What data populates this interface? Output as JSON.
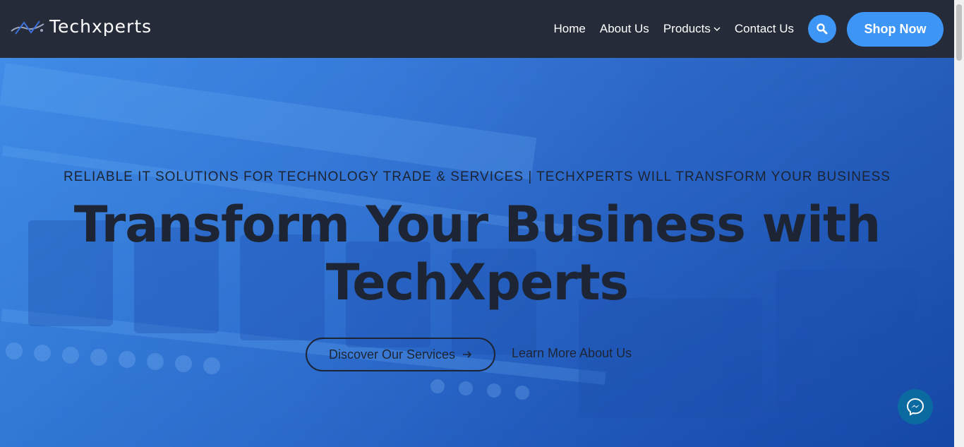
{
  "header": {
    "logo_text": "Techxperts",
    "nav": [
      {
        "label": "Home"
      },
      {
        "label": "About Us"
      },
      {
        "label": "Products"
      },
      {
        "label": "Contact Us"
      }
    ],
    "shop_label": "Shop Now"
  },
  "hero": {
    "tagline": "RELIABLE IT SOLUTIONS FOR TECHNOLOGY TRADE & SERVICES | TECHXPERTS WILL TRANSFORM YOUR BUSINESS",
    "headline_line1": "Transform Your Business with",
    "headline_line2": "TechXperts",
    "discover_label": "Discover Our Services",
    "learn_label": "Learn More About Us"
  },
  "colors": {
    "header_bg": "#252b38",
    "accent": "#3d95f5",
    "hero_blue": "#2a6fd6",
    "dark_text": "#1d2535",
    "messenger": "#0b6aa0"
  },
  "icons": [
    "logo-mark-icon",
    "chevron-down-icon",
    "search-icon",
    "arrow-right-icon",
    "messenger-icon"
  ]
}
